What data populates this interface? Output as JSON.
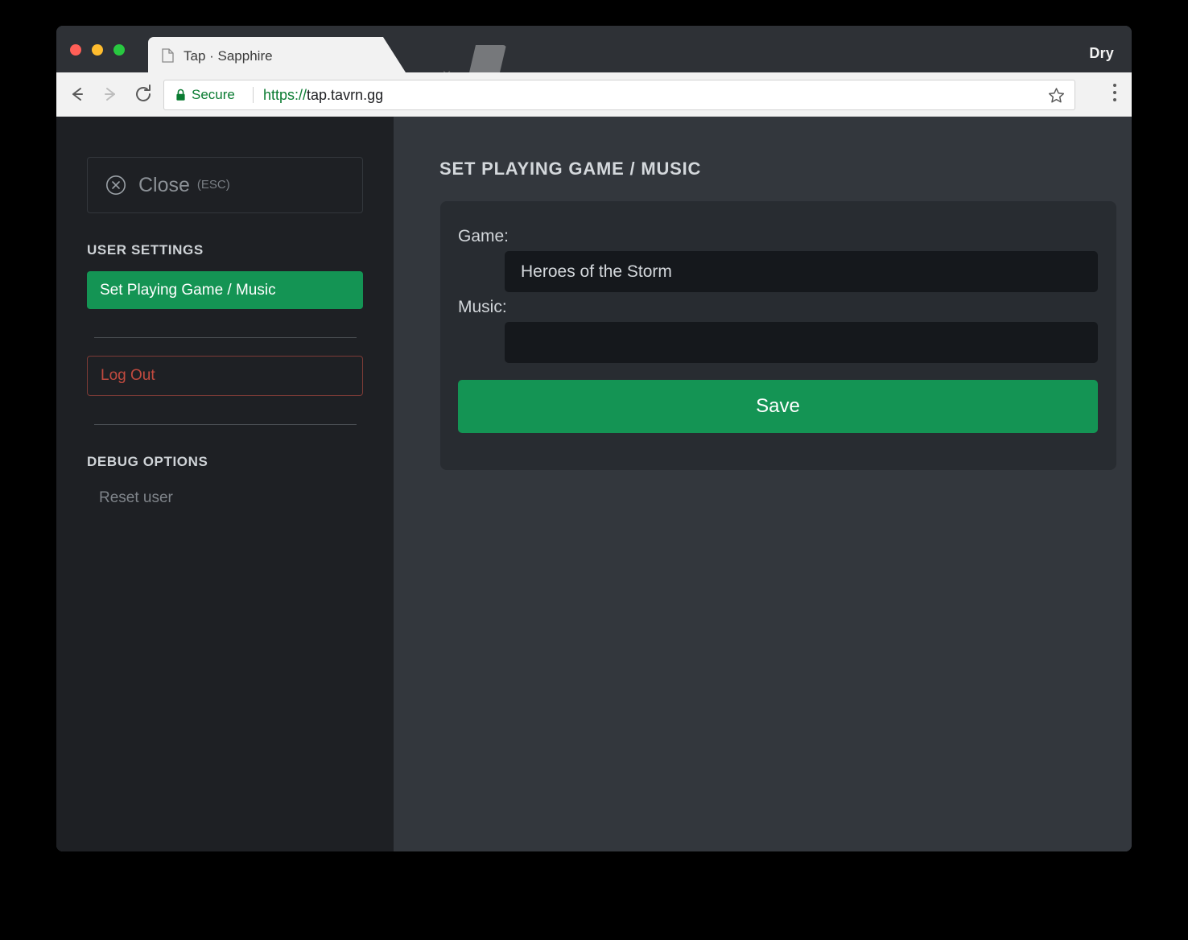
{
  "browser": {
    "tab": {
      "title": "Tap · Sapphire",
      "doc_icon": "document-icon",
      "close_icon": "×"
    },
    "profile_name": "Dry",
    "toolbar": {
      "back_icon": "back-arrow-icon",
      "forward_icon": "forward-arrow-icon",
      "reload_icon": "reload-icon",
      "lock_icon": "lock-icon",
      "secure_label": "Secure",
      "url_scheme": "https://",
      "url_host": "tap.tavrn.gg",
      "bookmark_icon": "star-icon",
      "menu_icon": "three-dots-icon"
    }
  },
  "sidebar": {
    "close": {
      "icon": "circle-x-icon",
      "label": "Close",
      "hint": "(ESC)"
    },
    "user_settings": {
      "section_title": "USER SETTINGS",
      "items": [
        {
          "label": "Set Playing Game / Music",
          "active": true
        }
      ]
    },
    "logout": {
      "label": "Log Out"
    },
    "debug": {
      "section_title": "DEBUG OPTIONS",
      "items": [
        {
          "label": "Reset user"
        }
      ]
    }
  },
  "main": {
    "heading": "SET PLAYING GAME / MUSIC",
    "form": {
      "game": {
        "label": "Game:",
        "value": "Heroes of the Storm",
        "placeholder": ""
      },
      "music": {
        "label": "Music:",
        "value": "",
        "placeholder": ""
      },
      "save_label": "Save"
    }
  },
  "colors": {
    "accent_green": "#149454",
    "danger_red": "#c14a3f",
    "sidebar_bg": "#1e2024",
    "main_bg": "#33373d",
    "card_bg": "#282c31",
    "input_bg": "#15181c",
    "secure_green": "#0a7b31",
    "traffic_red": "#ff5f57",
    "traffic_yellow": "#febc2e",
    "traffic_green": "#28c840"
  }
}
